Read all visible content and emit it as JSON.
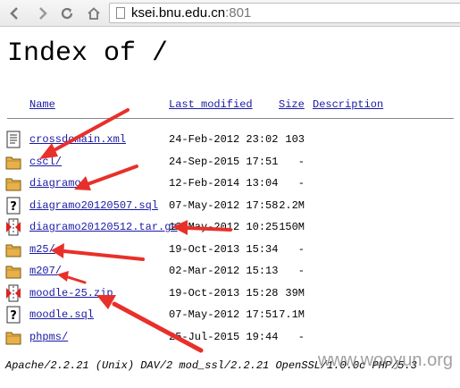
{
  "browser": {
    "url_host": "ksei.bnu.edu.cn",
    "url_port": ":801"
  },
  "page": {
    "title": "Index of /"
  },
  "table": {
    "headers": {
      "name": "Name",
      "modified": "Last modified",
      "size": "Size",
      "description": "Description"
    },
    "rows": [
      {
        "name": "crossdomain.xml",
        "modified": "24-Feb-2012 23:02",
        "size": "103",
        "icon": "text-file-icon"
      },
      {
        "name": "cscl/",
        "modified": "24-Sep-2015 17:51",
        "size": "-",
        "icon": "folder-icon"
      },
      {
        "name": "diagramo/",
        "modified": "12-Feb-2014 13:04",
        "size": "-",
        "icon": "folder-icon"
      },
      {
        "name": "diagramo20120507.sql",
        "modified": "07-May-2012 17:58",
        "size": "2.2M",
        "icon": "unknown-file-icon"
      },
      {
        "name": "diagramo20120512.tar.gz",
        "modified": "12-May-2012 10:25",
        "size": "150M",
        "icon": "archive-file-icon"
      },
      {
        "name": "m25/",
        "modified": "19-Oct-2013 15:34",
        "size": "-",
        "icon": "folder-icon"
      },
      {
        "name": "m207/",
        "modified": "02-Mar-2012 15:13",
        "size": "-",
        "icon": "folder-icon"
      },
      {
        "name": "moodle-25.zip",
        "modified": "19-Oct-2013 15:28",
        "size": "39M",
        "icon": "archive-file-icon"
      },
      {
        "name": "moodle.sql",
        "modified": "07-May-2012 17:51",
        "size": "7.1M",
        "icon": "unknown-file-icon"
      },
      {
        "name": "phpms/",
        "modified": "25-Jul-2015 19:44",
        "size": "-",
        "icon": "folder-icon"
      }
    ]
  },
  "footer": {
    "server": "Apache/2.2.21 (Unix) DAV/2 mod_ssl/2.2.21 OpenSSL/1.0.0c PHP/5.3"
  },
  "watermark": "www.wooyun.org",
  "colors": {
    "link": "#1a1aa6",
    "arrow": "#e8302a",
    "folder": "#e7b04a"
  }
}
